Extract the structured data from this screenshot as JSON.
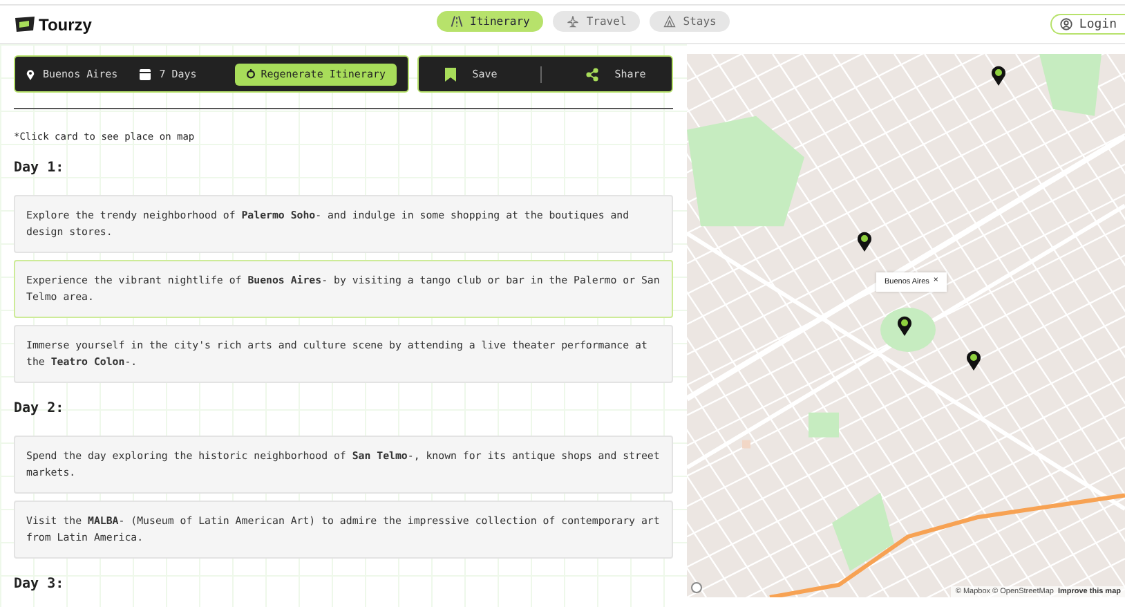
{
  "header": {
    "logo": "Tourzy",
    "tabs": [
      {
        "label": "Itinerary",
        "selected": true
      },
      {
        "label": "Travel",
        "selected": false
      },
      {
        "label": "Stays",
        "selected": false
      }
    ],
    "login": "Login"
  },
  "toolbar": {
    "location": "Buenos Aires",
    "duration": "7 Days",
    "regenerate": "Regenerate Itinerary",
    "save": "Save",
    "share": "Share"
  },
  "note": "*Click card to see place on map",
  "days": [
    {
      "title": "Day 1:",
      "activities": [
        {
          "text": "Explore the trendy neighborhood of **Palermo Soho**- and indulge in some shopping at the boutiques and design stores.",
          "selected": false
        },
        {
          "text": "Experience the vibrant nightlife of **Buenos Aires**- by visiting a tango club or bar in the Palermo or San Telmo area.",
          "selected": true
        },
        {
          "text": "Immerse yourself in the city's rich arts and culture scene by attending a live theater performance at the **Teatro Colon**-.",
          "selected": false
        }
      ]
    },
    {
      "title": "Day 2:",
      "activities": [
        {
          "text": "Spend the day exploring the historic neighborhood of **San Telmo**-, known for its antique shops and street markets.",
          "selected": false
        },
        {
          "text": "Visit the **MALBA**- (Museum of Latin American Art) to admire the impressive collection of contemporary art from Latin America.",
          "selected": false
        }
      ]
    },
    {
      "title": "Day 3:"
    }
  ],
  "map": {
    "popup": "Buenos Aires",
    "popup_close": "×",
    "attribution": "© Mapbox © OpenStreetMap",
    "improve_link": "Improve this map"
  }
}
